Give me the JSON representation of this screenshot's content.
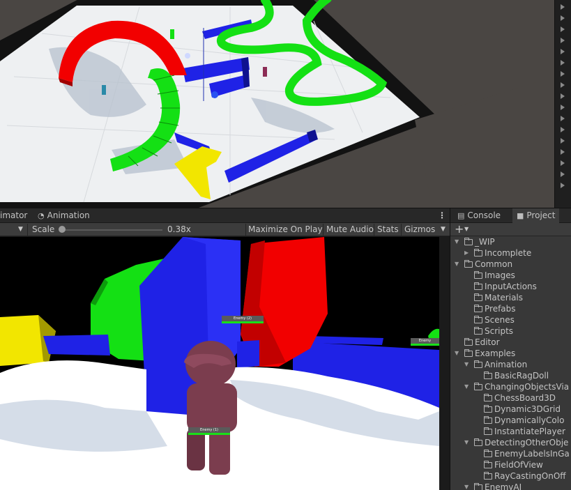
{
  "scene_tools": {
    "right_column_icons": [
      "play-arrow-icon",
      "play-arrow-icon",
      "play-arrow-icon",
      "play-arrow-icon",
      "play-arrow-icon",
      "play-arrow-icon",
      "play-arrow-icon",
      "play-arrow-icon",
      "play-arrow-icon",
      "play-arrow-icon",
      "play-arrow-icon",
      "play-arrow-icon",
      "play-arrow-icon",
      "play-arrow-icon",
      "play-arrow-icon",
      "play-arrow-icon",
      "play-arrow-icon"
    ]
  },
  "game_tabs": {
    "animator_label": "imator",
    "animation_label": "Animation",
    "menu_icon": "kebab-menu-icon"
  },
  "game_toolbar": {
    "dropdown_icon": "chevron-down-icon",
    "scale_label": "Scale",
    "scale_value": "0.38x",
    "scale_fraction": 0.0,
    "maximize_label": "Maximize On Play",
    "mute_label": "Mute Audio",
    "stats_label": "Stats",
    "gizmos_label": "Gizmos"
  },
  "game_view": {
    "enemy_labels": [
      "Enemy (2)",
      "Enemy",
      "Enemy (1)"
    ]
  },
  "right_tabs": {
    "console_label": "Console",
    "project_label": "Project"
  },
  "project_toolbar": {
    "add_icon": "plus-icon",
    "add_label": "+"
  },
  "project_tree": [
    {
      "label": "_WIP",
      "depth": 0,
      "expanded": true,
      "has_arrow": true
    },
    {
      "label": "Incomplete",
      "depth": 1,
      "expanded": false,
      "has_arrow": true
    },
    {
      "label": "Common",
      "depth": 0,
      "expanded": true,
      "has_arrow": true
    },
    {
      "label": "Images",
      "depth": 1,
      "expanded": false,
      "has_arrow": false
    },
    {
      "label": "InputActions",
      "depth": 1,
      "expanded": false,
      "has_arrow": false
    },
    {
      "label": "Materials",
      "depth": 1,
      "expanded": false,
      "has_arrow": false
    },
    {
      "label": "Prefabs",
      "depth": 1,
      "expanded": false,
      "has_arrow": false
    },
    {
      "label": "Scenes",
      "depth": 1,
      "expanded": false,
      "has_arrow": false
    },
    {
      "label": "Scripts",
      "depth": 1,
      "expanded": false,
      "has_arrow": false
    },
    {
      "label": "Editor",
      "depth": 0,
      "expanded": false,
      "has_arrow": false
    },
    {
      "label": "Examples",
      "depth": 0,
      "expanded": true,
      "has_arrow": true
    },
    {
      "label": "Animation",
      "depth": 1,
      "expanded": true,
      "has_arrow": true
    },
    {
      "label": "BasicRagDoll",
      "depth": 2,
      "expanded": false,
      "has_arrow": false
    },
    {
      "label": "ChangingObjectsVia",
      "depth": 1,
      "expanded": true,
      "has_arrow": true
    },
    {
      "label": "ChessBoard3D",
      "depth": 2,
      "expanded": false,
      "has_arrow": false
    },
    {
      "label": "Dynamic3DGrid",
      "depth": 2,
      "expanded": false,
      "has_arrow": false
    },
    {
      "label": "DynamicallyColo",
      "depth": 2,
      "expanded": false,
      "has_arrow": false
    },
    {
      "label": "InstantiatePlayer",
      "depth": 2,
      "expanded": false,
      "has_arrow": false
    },
    {
      "label": "DetectingOtherObje",
      "depth": 1,
      "expanded": true,
      "has_arrow": true
    },
    {
      "label": "EnemyLabelsInGa",
      "depth": 2,
      "expanded": false,
      "has_arrow": false
    },
    {
      "label": "FieldOfView",
      "depth": 2,
      "expanded": false,
      "has_arrow": false
    },
    {
      "label": "RayCastingOnOff",
      "depth": 2,
      "expanded": false,
      "has_arrow": false
    },
    {
      "label": "EnemyAI",
      "depth": 1,
      "expanded": true,
      "has_arrow": true
    }
  ],
  "colors": {
    "accent_blue": "#1f22e6",
    "accent_red": "#f20000",
    "accent_green": "#14e014",
    "accent_yellow": "#f2e600",
    "editor_panel": "#383838",
    "health_green": "#19e019"
  }
}
